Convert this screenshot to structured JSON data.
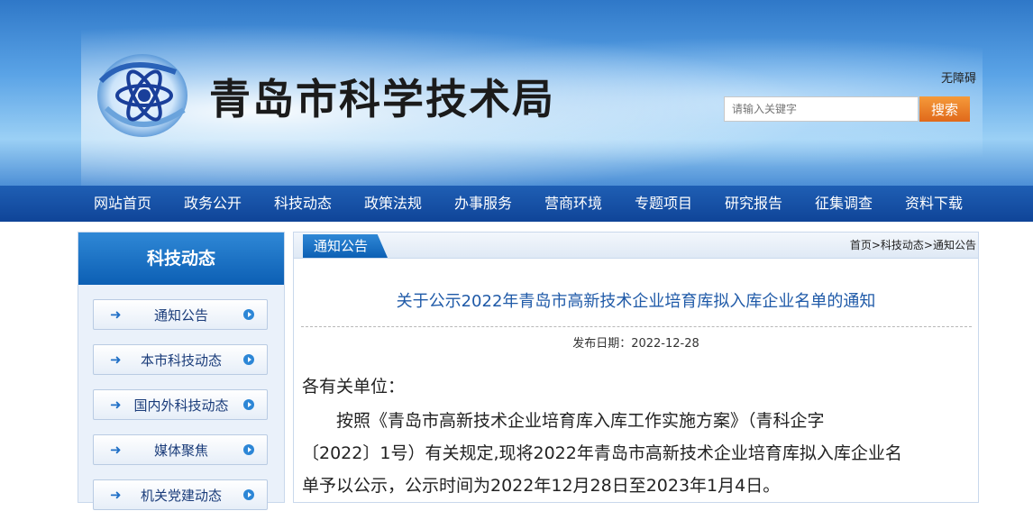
{
  "header": {
    "site_title": "青岛市科学技术局",
    "accessibility_link": "无障碍",
    "search_placeholder": "请输入关键字",
    "search_button": "搜索"
  },
  "nav": {
    "items": [
      "网站首页",
      "政务公开",
      "科技动态",
      "政策法规",
      "办事服务",
      "营商环境",
      "专题项目",
      "研究报告",
      "征集调查",
      "资料下载"
    ]
  },
  "sidebar": {
    "title": "科技动态",
    "items": [
      "通知公告",
      "本市科技动态",
      "国内外科技动态",
      "媒体聚焦",
      "机关党建动态"
    ]
  },
  "main": {
    "tab_label": "通知公告",
    "breadcrumb": [
      "首页",
      ">",
      "科技动态",
      ">",
      "通知公告"
    ],
    "article_title": "关于公示2022年青岛市高新技术企业培育库拟入库企业名单的通知",
    "publish_date": "发布日期：2022-12-28",
    "body_lines": [
      "各有关单位：",
      "　　按照《青岛市高新技术企业培育库入库工作实施方案》（青科企字",
      "〔2022〕1号）有关规定,现将2022年青岛市高新技术企业培育库拟入库企业名",
      "单予以公示，公示时间为2022年12月28日至2023年1月4日。"
    ]
  },
  "colors": {
    "nav_bg": "#1552a8",
    "accent_blue": "#1f5aa8",
    "search_orange": "#e8782a"
  },
  "icons": [
    "atom-logo-icon",
    "arrow-right-icon",
    "circle-play-icon"
  ]
}
